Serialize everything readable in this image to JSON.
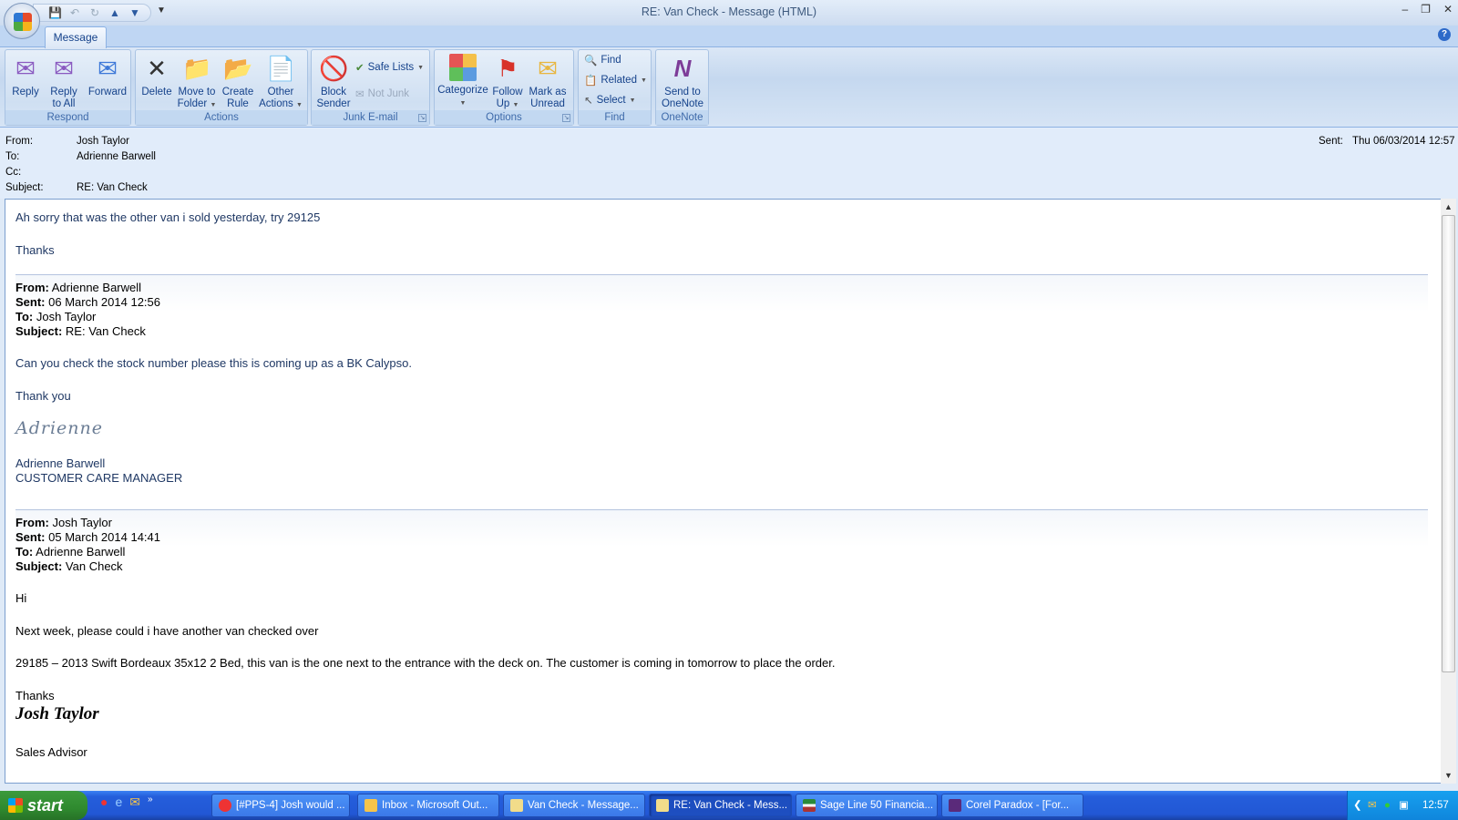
{
  "window": {
    "title": "RE: Van Check - Message (HTML)",
    "help": "?"
  },
  "ribbon": {
    "tab": "Message",
    "groups": {
      "respond": {
        "label": "Respond",
        "reply": "Reply",
        "reply_all": [
          "Reply",
          "to All"
        ],
        "forward": "Forward"
      },
      "actions": {
        "label": "Actions",
        "delete": "Delete",
        "move": [
          "Move to",
          "Folder"
        ],
        "rule": [
          "Create",
          "Rule"
        ],
        "other": [
          "Other",
          "Actions"
        ]
      },
      "junk": {
        "label": "Junk E-mail",
        "block": [
          "Block",
          "Sender"
        ],
        "safe_lists": "Safe Lists",
        "not_junk": "Not Junk"
      },
      "options": {
        "label": "Options",
        "categorize": "Categorize",
        "follow_up": [
          "Follow",
          "Up"
        ],
        "mark_unread": [
          "Mark as",
          "Unread"
        ]
      },
      "find": {
        "label": "Find",
        "find": "Find",
        "related": "Related",
        "select": "Select"
      },
      "onenote": {
        "label": "OneNote",
        "send": [
          "Send to",
          "OneNote"
        ]
      }
    }
  },
  "header": {
    "from_label": "From:",
    "from": "Josh Taylor",
    "to_label": "To:",
    "to": "Adrienne Barwell",
    "cc_label": "Cc:",
    "cc": "",
    "subject_label": "Subject:",
    "subject": "RE: Van Check",
    "sent_label": "Sent:",
    "sent": "Thu 06/03/2014 12:57"
  },
  "message": {
    "reply": {
      "line1": "Ah sorry that was the other van i sold yesterday, try 29125",
      "line2": "Thanks"
    },
    "quoted1": {
      "from_label": "From:",
      "from": "Adrienne Barwell",
      "sent_label": "Sent:",
      "sent": "06 March 2014 12:56",
      "to_label": "To:",
      "to": "Josh Taylor",
      "subject_label": "Subject:",
      "subject": "RE: Van Check",
      "line1": "Can you check the stock number please this is coming up as a BK Calypso.",
      "line2": "Thank you",
      "signature": "Adrienne",
      "name": "Adrienne Barwell",
      "title": "CUSTOMER CARE MANAGER"
    },
    "quoted2": {
      "from_label": "From:",
      "from": "Josh Taylor",
      "sent_label": "Sent:",
      "sent": "05 March 2014 14:41",
      "to_label": "To:",
      "to": "Adrienne Barwell",
      "subject_label": "Subject:",
      "subject": "Van Check",
      "line1": "Hi",
      "line2": "Next week, please could i have another van checked over",
      "line3": "29185 – 2013 Swift Bordeaux 35x12 2 Bed, this van is the one next to the entrance with the deck on. The customer is coming in tomorrow to place the order.",
      "line4": "Thanks",
      "signature": "Josh Taylor",
      "title": "Sales Advisor"
    }
  },
  "taskbar": {
    "start": "start",
    "buttons": [
      {
        "label": "[#PPS-4] Josh would ...",
        "icon": "chrome-icon"
      },
      {
        "label": "Inbox - Microsoft Out...",
        "icon": "outlook-icon"
      },
      {
        "label": "Van Check - Message...",
        "icon": "mail-icon"
      },
      {
        "label": "RE: Van Check - Mess...",
        "icon": "mail-icon",
        "active": true
      },
      {
        "label": "Sage Line 50 Financia...",
        "icon": "sage-icon"
      },
      {
        "label": "Corel Paradox - [For...",
        "icon": "paradox-icon"
      }
    ],
    "clock": "12:57"
  }
}
